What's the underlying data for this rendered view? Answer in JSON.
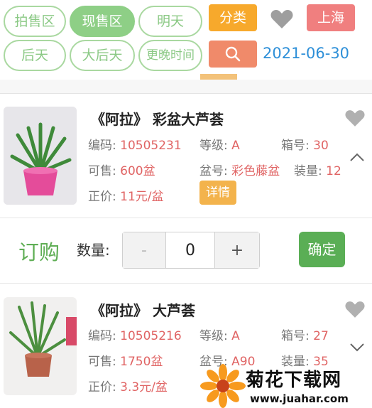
{
  "filters": {
    "auction": "拍售区",
    "spot": "现售区",
    "tomorrow": "明天",
    "day_after": "后天",
    "day_after_after": "大后天",
    "later": "更晚时间"
  },
  "toolbar": {
    "category": "分类",
    "city": "上海",
    "date": "2021-06-30",
    "colors": {
      "accent_green": "#8ecf86",
      "category_orange": "#f7a92c",
      "city_red": "#f07f7f",
      "date_blue": "#2d8fd8"
    }
  },
  "products": [
    {
      "title": "《阿拉》 彩盆大芦荟",
      "code_label": "编码:",
      "code": "10505231",
      "grade_label": "等级:",
      "grade": "A",
      "box_label": "箱号:",
      "box": "30",
      "avail_label": "可售:",
      "avail": "600盆",
      "pot_label": "盆号:",
      "pot": "彩色藤盆",
      "load_label": "装量:",
      "load": "12",
      "price_label": "正价:",
      "price": "11元/盆",
      "detail": "详情",
      "expanded": true
    },
    {
      "title": "《阿拉》 大芦荟",
      "code_label": "编码:",
      "code": "10505216",
      "grade_label": "等级:",
      "grade": "A",
      "box_label": "箱号:",
      "box": "27",
      "avail_label": "可售:",
      "avail": "1750盆",
      "pot_label": "盆号:",
      "pot": "A90",
      "load_label": "装量:",
      "load": "35",
      "price_label": "正价:",
      "price": "3.3元/盆",
      "expanded": false
    }
  ],
  "order": {
    "label": "订购",
    "qty_label": "数量:",
    "minus": "-",
    "qty": "0",
    "plus": "+",
    "confirm": "确定"
  },
  "watermark": {
    "title": "菊花下载网",
    "url": "www.juahar.com"
  }
}
